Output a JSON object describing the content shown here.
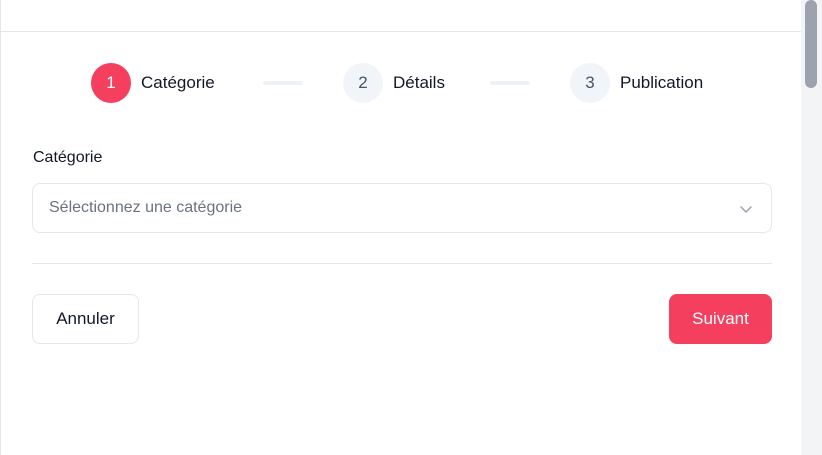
{
  "stepper": {
    "steps": [
      {
        "number": "1",
        "label": "Catégorie",
        "state": "active"
      },
      {
        "number": "2",
        "label": "Détails",
        "state": "inactive"
      },
      {
        "number": "3",
        "label": "Publication",
        "state": "inactive"
      }
    ]
  },
  "form": {
    "category_label": "Catégorie",
    "category_placeholder": "Sélectionnez une catégorie"
  },
  "actions": {
    "cancel_label": "Annuler",
    "next_label": "Suivant"
  },
  "colors": {
    "accent": "#f43f5e",
    "inactive_step_bg": "#f1f5f9",
    "border": "#e5e7eb"
  },
  "icons": {
    "select_chevron": "chevron-down-icon"
  }
}
